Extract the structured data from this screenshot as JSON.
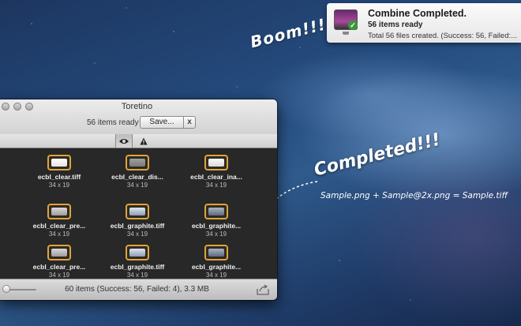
{
  "notification": {
    "title": "Combine Completed.",
    "subtitle": "56 items ready",
    "body": "Total 56 files created. (Success: 56, Failed:..."
  },
  "annotations": {
    "boom": "Boom!!!",
    "completed": "Completed!!!",
    "formula": "Sample.png + Sample@2x.png = Sample.tiff"
  },
  "window": {
    "title": "Toretino",
    "ready_label": "56 items ready",
    "save_label": "Save...",
    "cancel_label": "x",
    "items": [
      {
        "name": "ecbl_clear.tiff",
        "size": "34 x 19",
        "thumb": "clear"
      },
      {
        "name": "ecbl_clear_dis...",
        "size": "34 x 19",
        "thumb": "dis"
      },
      {
        "name": "ecbl_clear_ina...",
        "size": "34 x 19",
        "thumb": "ina"
      },
      {
        "name": "ecbl_clear_pre...",
        "size": "34 x 19",
        "thumb": "pre"
      },
      {
        "name": "ecbl_graphite.tiff",
        "size": "34 x 19",
        "thumb": "gra"
      },
      {
        "name": "ecbl_graphite...",
        "size": "34 x 19",
        "thumb": "grd"
      },
      {
        "name": "ecbl_clear_pre...",
        "size": "34 x 19",
        "thumb": "pre"
      },
      {
        "name": "ecbl_graphite.tiff",
        "size": "34 x 19",
        "thumb": "gra"
      },
      {
        "name": "ecbl_graphite...",
        "size": "34 x 19",
        "thumb": "grd"
      }
    ],
    "status": "60 items (Success: 56, Failed: 4), 3.3 MB"
  },
  "icons": {
    "app": "monitor-app-icon",
    "check": "checkmark-icon",
    "eye": "eye-icon",
    "warning": "warning-icon",
    "share": "share-icon"
  },
  "colors": {
    "thumb_border": "#e0a43a",
    "grid_bg": "#282828"
  }
}
